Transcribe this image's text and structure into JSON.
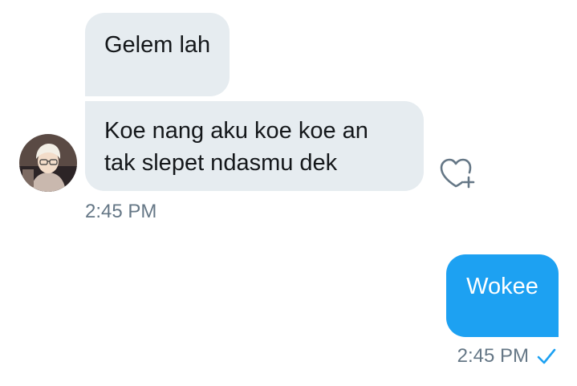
{
  "conversation": {
    "incoming_messages": [
      {
        "lines": [
          "Gelem lah"
        ]
      },
      {
        "lines": [
          "Koe nang aku koe koe an",
          "tak slepet ndasmu dek"
        ]
      }
    ],
    "incoming_timestamp": "2:45 PM",
    "outgoing_messages": [
      {
        "text": "Wokee"
      }
    ],
    "outgoing_timestamp": "2:45 PM"
  },
  "icons": {
    "avatar": "user-avatar",
    "like": "heart-plus-icon",
    "status": "checkmark-icon"
  },
  "colors": {
    "incoming_bubble": "#e6ecf0",
    "outgoing_bubble": "#1da1f2",
    "timestamp": "#657786",
    "read_check": "#1da1f2"
  }
}
